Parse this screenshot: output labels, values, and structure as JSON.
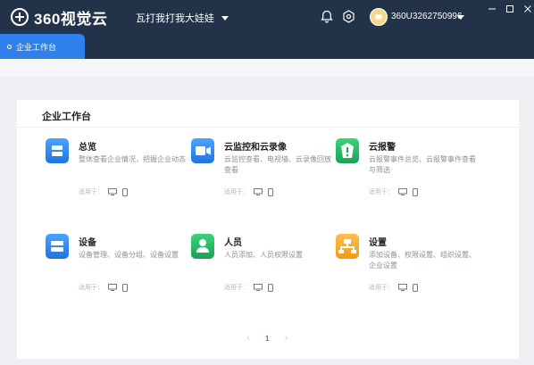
{
  "app": {
    "logo_text": "360视觉云",
    "workspace": "瓦打我打我大娃娃",
    "username": "360U3262750996"
  },
  "tab": {
    "label": "企业工作台"
  },
  "panel": {
    "title": "企业工作台"
  },
  "cards": [
    {
      "title": "总览",
      "desc": "整体查看企业情况，把握企业动态",
      "apply": "适用于：",
      "icon": "overview-icon",
      "color": "#2f80ed"
    },
    {
      "title": "云监控和云录像",
      "desc": "云监控查看、电视墙、云录像回放查看",
      "apply": "适用于：",
      "icon": "camera-icon",
      "color": "#2f80ed"
    },
    {
      "title": "云报警",
      "desc": "云报警事件总览、云报警事件查看与筛选",
      "apply": "适用于：",
      "icon": "alarm-icon",
      "color": "#1aa85a"
    },
    {
      "title": "设备",
      "desc": "设备管理、设备分组、设备设置",
      "apply": "适用于：",
      "icon": "device-icon",
      "color": "#2f80ed"
    },
    {
      "title": "人员",
      "desc": "人员添加、人员权限设置",
      "apply": "适用于：",
      "icon": "person-icon",
      "color": "#1aa85a"
    },
    {
      "title": "设置",
      "desc": "添加设备、权限设置、组织设置、企业设置",
      "apply": "适用于：",
      "icon": "settings-org-icon",
      "color": "#f5a623"
    }
  ],
  "pagination": {
    "prev": "‹",
    "current": "1",
    "next": "›"
  }
}
